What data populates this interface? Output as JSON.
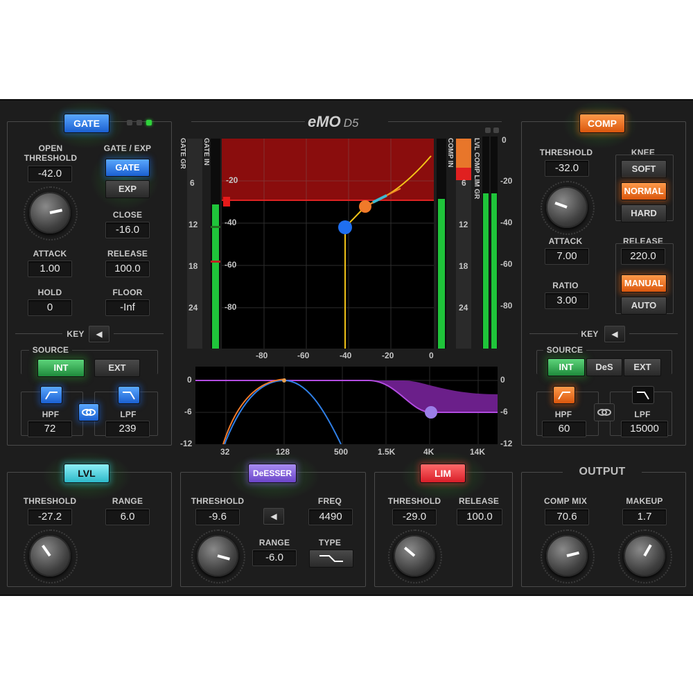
{
  "brand": {
    "logo": "eMO",
    "model": "D5"
  },
  "gate": {
    "module": "GATE",
    "open_threshold_label": "OPEN\nTHRESHOLD",
    "open_threshold": "-42.0",
    "mode_label": "GATE / EXP",
    "mode_gate": "GATE",
    "mode_exp": "EXP",
    "close_label": "CLOSE",
    "close": "-16.0",
    "attack_label": "ATTACK",
    "attack": "1.00",
    "release_label": "RELEASE",
    "release": "100.0",
    "hold_label": "HOLD",
    "hold": "0",
    "floor_label": "FLOOR",
    "floor": "-Inf",
    "key_label": "KEY",
    "source_label": "SOURCE",
    "src_int": "INT",
    "src_ext": "EXT",
    "hpf_label": "HPF",
    "hpf": "72",
    "lpf_label": "LPF",
    "lpf": "239",
    "knob_level": 0.35
  },
  "comp": {
    "module": "COMP",
    "threshold_label": "THRESHOLD",
    "threshold": "-32.0",
    "knee_label": "KNEE",
    "knee_soft": "SOFT",
    "knee_normal": "NORMAL",
    "knee_hard": "HARD",
    "attack_label": "ATTACK",
    "attack": "7.00",
    "release_label": "RELEASE",
    "release": "220.0",
    "ratio_label": "RATIO",
    "ratio": "3.00",
    "rel_manual": "MANUAL",
    "rel_auto": "AUTO",
    "key_label": "KEY",
    "source_label": "SOURCE",
    "src_int": "INT",
    "src_des": "DeS",
    "src_ext": "EXT",
    "hpf_label": "HPF",
    "hpf": "60",
    "lpf_label": "LPF",
    "lpf": "15000",
    "knob_level": 0.42
  },
  "meters": {
    "gate_gr": "GATE GR",
    "gate_in": "GATE IN",
    "gr_ticks": [
      "6",
      "12",
      "18",
      "24"
    ],
    "comp_in": "COMP IN",
    "lvl_comp_lim_gr": "LVL COMP LIM GR",
    "out_ticks": [
      "0",
      "-20",
      "-40",
      "-60",
      "-80"
    ]
  },
  "transfer_graph": {
    "y_ticks": [
      "-20",
      "-40",
      "-60",
      "-80"
    ],
    "x_ticks": [
      "-80",
      "-60",
      "-40",
      "-20",
      "0"
    ]
  },
  "eq_graph": {
    "y_ticks": [
      "0",
      "-6",
      "-12"
    ],
    "x_ticks": [
      "32",
      "128",
      "500",
      "1.5K",
      "4K",
      "14K"
    ]
  },
  "lvl": {
    "module": "LVL",
    "threshold_label": "THRESHOLD",
    "threshold": "-27.2",
    "range_label": "RANGE",
    "range": "6.0"
  },
  "desser": {
    "module": "DeESSER",
    "threshold_label": "THRESHOLD",
    "threshold": "-9.6",
    "freq_label": "FREQ",
    "freq": "4490",
    "range_label": "RANGE",
    "range": "-6.0",
    "type_label": "TYPE"
  },
  "lim": {
    "module": "LIM",
    "threshold_label": "THRESHOLD",
    "threshold": "-29.0",
    "release_label": "RELEASE",
    "release": "100.0"
  },
  "output": {
    "title": "OUTPUT",
    "comp_mix_label": "COMP MIX",
    "comp_mix": "70.6",
    "makeup_label": "MAKEUP",
    "makeup": "1.7"
  },
  "colors": {
    "gate": "#2f7fe6",
    "comp": "#f07a2a",
    "lvl": "#39c4d1",
    "desser": "#8a5ee0",
    "lim": "#e8323a",
    "meter_green": "#1fc43a"
  }
}
